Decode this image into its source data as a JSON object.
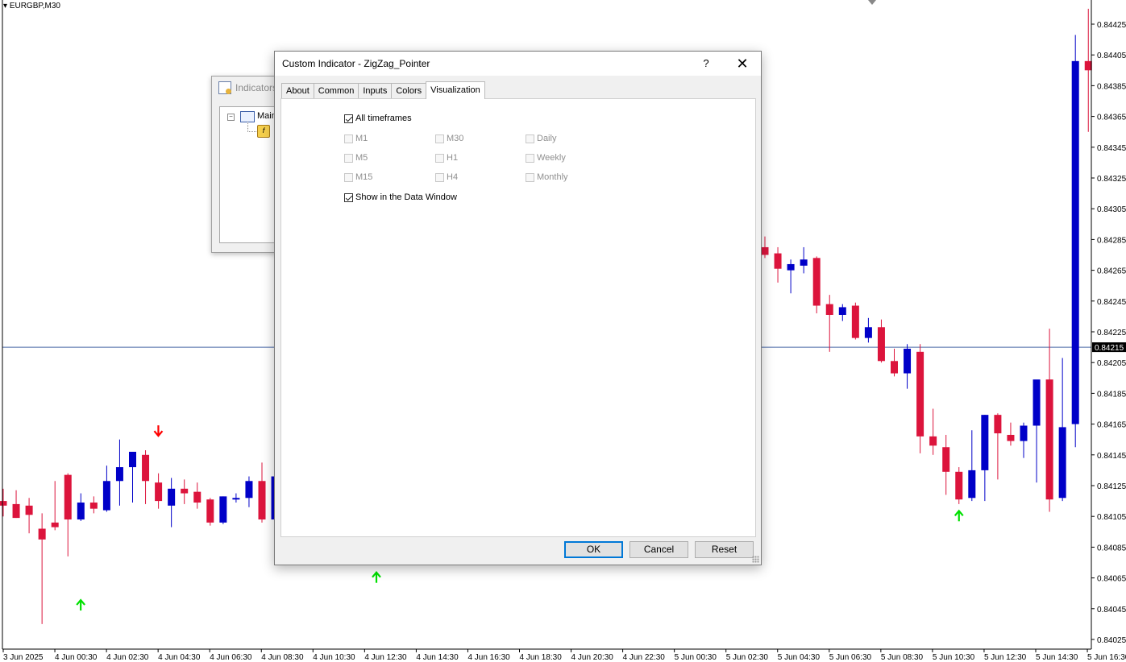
{
  "chart": {
    "symbol": "EURGBP,M30",
    "current_price": "0.84215",
    "price_labels": [
      "0.84425",
      "0.84405",
      "0.84385",
      "0.84365",
      "0.84345",
      "0.84325",
      "0.84305",
      "0.84285",
      "0.84265",
      "0.84245",
      "0.84225",
      "0.84205",
      "0.84185",
      "0.84165",
      "0.84145",
      "0.84125",
      "0.84105",
      "0.84085",
      "0.84065",
      "0.84045",
      "0.84025"
    ],
    "time_labels": [
      "3 Jun 2025",
      "4 Jun 00:30",
      "4 Jun 02:30",
      "4 Jun 04:30",
      "4 Jun 06:30",
      "4 Jun 08:30",
      "4 Jun 10:30",
      "4 Jun 12:30",
      "4 Jun 14:30",
      "4 Jun 16:30",
      "4 Jun 18:30",
      "4 Jun 20:30",
      "4 Jun 22:30",
      "5 Jun 00:30",
      "5 Jun 02:30",
      "5 Jun 04:30",
      "5 Jun 06:30",
      "5 Jun 08:30",
      "5 Jun 10:30",
      "5 Jun 12:30",
      "5 Jun 14:30",
      "5 Jun 16:30"
    ],
    "colors": {
      "bull": "#0000c8",
      "bear": "#dc143c",
      "grid_line": "#4a6aa8",
      "arrow_up": "#00e000",
      "arrow_down": "#ff0000"
    },
    "candles_left": [
      {
        "o": 0.84115,
        "h": 0.84123,
        "l": 0.84105,
        "c": 0.84112
      },
      {
        "o": 0.84113,
        "h": 0.84122,
        "l": 0.84104,
        "c": 0.84104
      },
      {
        "o": 0.84112,
        "h": 0.84117,
        "l": 0.84094,
        "c": 0.84106
      },
      {
        "o": 0.84097,
        "h": 0.84107,
        "l": 0.84035,
        "c": 0.8409
      },
      {
        "o": 0.84101,
        "h": 0.84128,
        "l": 0.84096,
        "c": 0.84098
      },
      {
        "o": 0.84132,
        "h": 0.84133,
        "l": 0.84079,
        "c": 0.84103
      },
      {
        "o": 0.84103,
        "h": 0.8412,
        "l": 0.84102,
        "c": 0.84114
      },
      {
        "o": 0.84114,
        "h": 0.84118,
        "l": 0.84107,
        "c": 0.8411
      },
      {
        "o": 0.84109,
        "h": 0.84138,
        "l": 0.84108,
        "c": 0.84128
      },
      {
        "o": 0.84128,
        "h": 0.84155,
        "l": 0.84112,
        "c": 0.84137
      },
      {
        "o": 0.84137,
        "h": 0.84145,
        "l": 0.84114,
        "c": 0.84147
      },
      {
        "o": 0.84145,
        "h": 0.84148,
        "l": 0.84113,
        "c": 0.84128
      },
      {
        "o": 0.84127,
        "h": 0.84133,
        "l": 0.8411,
        "c": 0.84115
      },
      {
        "o": 0.84112,
        "h": 0.8413,
        "l": 0.84098,
        "c": 0.84123
      },
      {
        "o": 0.84123,
        "h": 0.84129,
        "l": 0.84113,
        "c": 0.8412
      },
      {
        "o": 0.84121,
        "h": 0.84127,
        "l": 0.8411,
        "c": 0.84114
      },
      {
        "o": 0.84116,
        "h": 0.84117,
        "l": 0.84099,
        "c": 0.84101
      },
      {
        "o": 0.84101,
        "h": 0.84118,
        "l": 0.841,
        "c": 0.84118
      },
      {
        "o": 0.84116,
        "h": 0.8412,
        "l": 0.84114,
        "c": 0.84117
      },
      {
        "o": 0.84117,
        "h": 0.84131,
        "l": 0.84111,
        "c": 0.84128
      },
      {
        "o": 0.84128,
        "h": 0.8414,
        "l": 0.84101,
        "c": 0.84103
      },
      {
        "o": 0.84103,
        "h": 0.84135,
        "l": 0.84084,
        "c": 0.84131
      }
    ],
    "candles_right": [
      {
        "o": 0.8428,
        "h": 0.84287,
        "l": 0.84273,
        "c": 0.84275
      },
      {
        "o": 0.84276,
        "h": 0.8428,
        "l": 0.84257,
        "c": 0.84266
      },
      {
        "o": 0.84265,
        "h": 0.84272,
        "l": 0.8425,
        "c": 0.84269
      },
      {
        "o": 0.84268,
        "h": 0.8428,
        "l": 0.84263,
        "c": 0.84272
      },
      {
        "o": 0.84273,
        "h": 0.84274,
        "l": 0.84237,
        "c": 0.84242
      },
      {
        "o": 0.84243,
        "h": 0.84249,
        "l": 0.84212,
        "c": 0.84236
      },
      {
        "o": 0.84236,
        "h": 0.84243,
        "l": 0.84232,
        "c": 0.84241
      },
      {
        "o": 0.84242,
        "h": 0.84244,
        "l": 0.8422,
        "c": 0.84221
      },
      {
        "o": 0.84221,
        "h": 0.84234,
        "l": 0.84218,
        "c": 0.84228
      },
      {
        "o": 0.84228,
        "h": 0.84233,
        "l": 0.84205,
        "c": 0.84206
      },
      {
        "o": 0.84206,
        "h": 0.84214,
        "l": 0.84196,
        "c": 0.84198
      },
      {
        "o": 0.84198,
        "h": 0.84217,
        "l": 0.84188,
        "c": 0.84214
      },
      {
        "o": 0.84212,
        "h": 0.84217,
        "l": 0.84146,
        "c": 0.84157
      },
      {
        "o": 0.84157,
        "h": 0.84175,
        "l": 0.84145,
        "c": 0.84151
      },
      {
        "o": 0.8415,
        "h": 0.84158,
        "l": 0.84119,
        "c": 0.84134
      },
      {
        "o": 0.84134,
        "h": 0.84137,
        "l": 0.84113,
        "c": 0.84116
      },
      {
        "o": 0.84117,
        "h": 0.84161,
        "l": 0.84115,
        "c": 0.84135
      },
      {
        "o": 0.84135,
        "h": 0.84171,
        "l": 0.84115,
        "c": 0.84171
      },
      {
        "o": 0.84171,
        "h": 0.84172,
        "l": 0.84129,
        "c": 0.84159
      },
      {
        "o": 0.84158,
        "h": 0.84166,
        "l": 0.84151,
        "c": 0.84154
      },
      {
        "o": 0.84154,
        "h": 0.84166,
        "l": 0.84143,
        "c": 0.84164
      },
      {
        "o": 0.84164,
        "h": 0.84186,
        "l": 0.84127,
        "c": 0.84194
      },
      {
        "o": 0.84194,
        "h": 0.84227,
        "l": 0.84108,
        "c": 0.84116
      },
      {
        "o": 0.84117,
        "h": 0.84208,
        "l": 0.84115,
        "c": 0.84163
      },
      {
        "o": 0.84165,
        "h": 0.84418,
        "l": 0.8415,
        "c": 0.84401
      },
      {
        "o": 0.84401,
        "h": 0.84435,
        "l": 0.84355,
        "c": 0.84395
      }
    ],
    "arrows": [
      {
        "dir": "up",
        "price": 0.84048,
        "idx_side": "left",
        "idx": 3
      },
      {
        "dir": "down",
        "price": 0.8416,
        "idx_side": "left",
        "idx": 9
      },
      {
        "dir": "up",
        "price": 0.8408,
        "idx_side": "left",
        "idx": 21
      },
      {
        "dir": "up",
        "price": 0.84066,
        "idx_side": "mid",
        "idx": 0
      },
      {
        "dir": "up",
        "price": 0.84106,
        "idx_side": "right",
        "idx": 15
      }
    ]
  },
  "navigator": {
    "title": "Indicators",
    "tree_item": "Main"
  },
  "dialog": {
    "title": "Custom Indicator - ZigZag_Pointer",
    "help_label": "?",
    "close_label": "✕",
    "tabs": [
      {
        "label": "About",
        "active": false
      },
      {
        "label": "Common",
        "active": false
      },
      {
        "label": "Inputs",
        "active": false
      },
      {
        "label": "Colors",
        "active": false
      },
      {
        "label": "Visualization",
        "active": true
      }
    ],
    "all_timeframes": {
      "label": "All timeframes",
      "checked": true
    },
    "timeframes": [
      {
        "label": "M1",
        "checked": false,
        "enabled": false
      },
      {
        "label": "M5",
        "checked": false,
        "enabled": false
      },
      {
        "label": "M15",
        "checked": false,
        "enabled": false
      },
      {
        "label": "M30",
        "checked": false,
        "enabled": false
      },
      {
        "label": "H1",
        "checked": false,
        "enabled": false
      },
      {
        "label": "H4",
        "checked": false,
        "enabled": false
      },
      {
        "label": "Daily",
        "checked": false,
        "enabled": false
      },
      {
        "label": "Weekly",
        "checked": false,
        "enabled": false
      },
      {
        "label": "Monthly",
        "checked": false,
        "enabled": false
      }
    ],
    "show_data_window": {
      "label": "Show in the Data Window",
      "checked": true
    },
    "buttons": {
      "ok": "OK",
      "cancel": "Cancel",
      "reset": "Reset"
    }
  }
}
